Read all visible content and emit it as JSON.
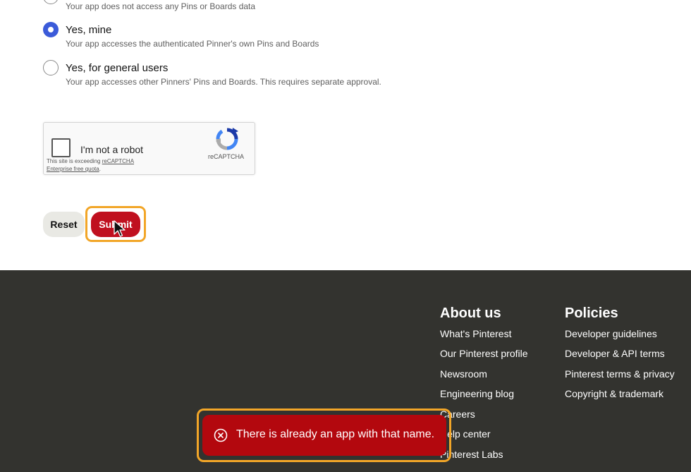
{
  "access_options": [
    {
      "title": "",
      "description": "Your app does not access any Pins or Boards data",
      "selected": false
    },
    {
      "title": "Yes, mine",
      "description": "Your app accesses the authenticated Pinner's own Pins and Boards",
      "selected": true
    },
    {
      "title": "Yes, for general users",
      "description": "Your app accesses other Pinners' Pins and Boards. This requires separate approval.",
      "selected": false
    }
  ],
  "captcha": {
    "label": "I'm not a robot",
    "warning_prefix": "This site is exceeding ",
    "warning_link": "reCAPTCHA Enterprise free quota",
    "warning_suffix": ".",
    "brand": "reCAPTCHA",
    "icon": "recaptcha-logo-icon"
  },
  "buttons": {
    "reset_label": "Reset",
    "submit_label": "Submit"
  },
  "footer": {
    "about": {
      "heading": "About us",
      "links": [
        "What's Pinterest",
        "Our Pinterest profile",
        "Newsroom",
        "Engineering blog",
        "Careers",
        "Help center",
        "Pinterest Labs"
      ]
    },
    "policies": {
      "heading": "Policies",
      "links": [
        "Developer guidelines",
        "Developer & API terms",
        "Pinterest terms & privacy",
        "Copyright & trademark"
      ]
    }
  },
  "toast": {
    "message": "There is already an app with that name.",
    "icon": "error-x-circle-icon"
  },
  "colors": {
    "accent_red": "#c0101f",
    "toast_red": "#b3080e",
    "radio_blue": "#3b5bd9",
    "footer_bg": "#33332f",
    "highlight_orange": "#f2a628"
  }
}
